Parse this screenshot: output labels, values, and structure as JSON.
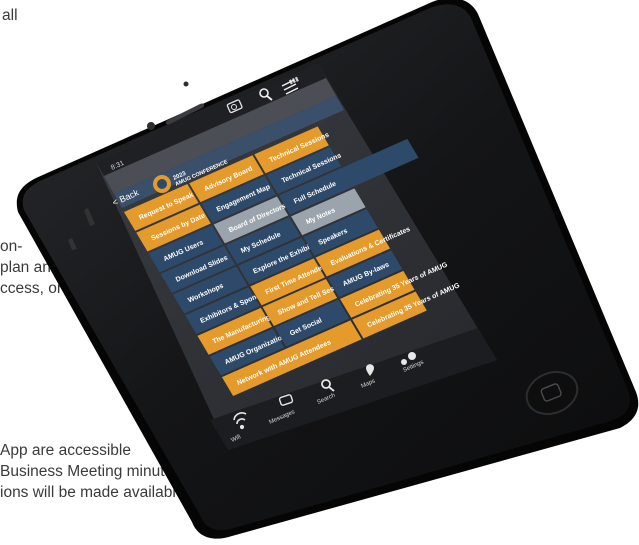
{
  "page_text": {
    "line1": "all",
    "line2": "on-",
    "line3": "plan and",
    "line4": "ccess, or",
    "line5": " App are accessible",
    "line6": "Business Meeting minutes,",
    "line7": "ions will be made available. New"
  },
  "status_bar": {
    "time": "8:31"
  },
  "header": {
    "back_label": "< Back",
    "year": "2023",
    "title": "AMUG CONFERENCE"
  },
  "tiles": {
    "request_to_speak": "Request to Speak",
    "advisory": "Advisory Board",
    "technical_sessions": "Technical Sessions",
    "sessions_by_date": "Sessions by Date",
    "engagement": "Engagement Map",
    "amug_users": "AMUG Users",
    "board": "Board of Directors",
    "full_schedule": "Full Schedule",
    "download_slides": "Download Slides",
    "my_schedule": "My Schedule",
    "my_notes": "My Notes",
    "workshops": "Workshops",
    "explore_exhibitors": "Explore the Exhibitors",
    "speakers": "Speakers",
    "exhibitors_sponsors": "Exhibitors & Sponsors",
    "first_time": "First Time Attendees",
    "manufacturing_team": "The Manufacturing Team",
    "evaluations": "Evaluations & Certificates",
    "show_and_tell": "Show and Tell Sessions",
    "amug_bylaws": "AMUG By-laws",
    "amug_organization": "AMUG Organization",
    "get_social": "Get Social",
    "celebrating": "Celebrating 35 Years of AMUG",
    "network": "Network with AMUG Attendees"
  },
  "tabbar": [
    "Wifi",
    "Messages",
    "Search",
    "Maps",
    "Settings"
  ],
  "colors": {
    "orange": "#E59A2C",
    "navy": "#2E4A6B",
    "gray": "#9BA3AC",
    "phone_body": "#1A1B1D",
    "screen_bg": "#2B2E33"
  },
  "icons": [
    "camera-icon",
    "search-icon",
    "menu-icon",
    "wifi-icon",
    "chat-icon",
    "pin-icon",
    "gears-icon"
  ]
}
